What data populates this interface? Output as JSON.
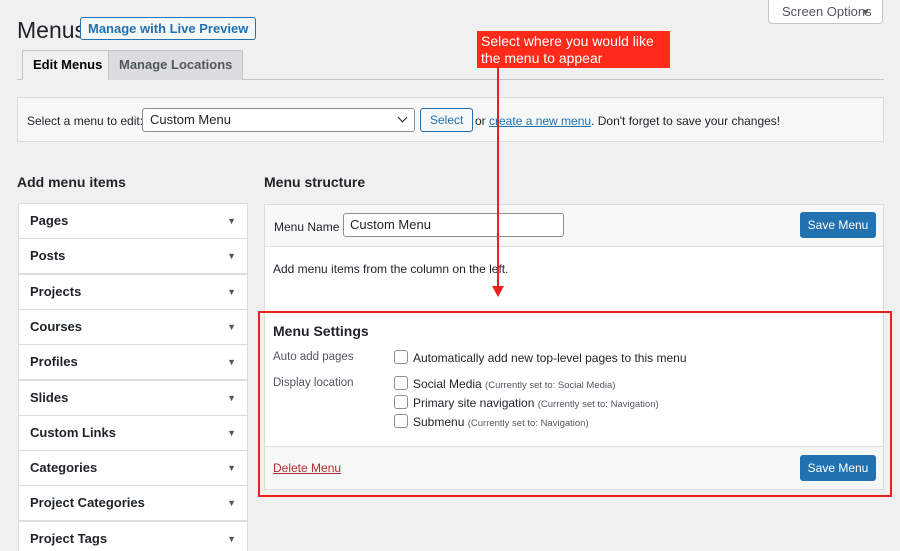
{
  "header": {
    "title": "Menus",
    "live_preview_label": "Manage with Live Preview",
    "screen_options_label": "Screen Options"
  },
  "tabs": [
    {
      "label": "Edit Menus",
      "active": true
    },
    {
      "label": "Manage Locations",
      "active": false
    }
  ],
  "select_menu": {
    "label": "Select a menu to edit:",
    "selected_value": "Custom Menu",
    "select_button": "Select",
    "or_text": "or",
    "create_link": "create a new menu",
    "reminder": ". Don't forget to save your changes!"
  },
  "add_items": {
    "heading": "Add menu items",
    "items": [
      "Pages",
      "Posts",
      "Projects",
      "Courses",
      "Profiles",
      "Slides",
      "Custom Links",
      "Categories",
      "Project Categories",
      "Project Tags"
    ]
  },
  "structure": {
    "heading": "Menu structure",
    "menu_name_label": "Menu Name",
    "menu_name_value": "Custom Menu",
    "save_label": "Save Menu",
    "description": "Add menu items from the column on the left."
  },
  "settings": {
    "heading": "Menu Settings",
    "auto_add_label": "Auto add pages",
    "auto_add_option": "Automatically add new top-level pages to this menu",
    "display_location_label": "Display location",
    "locations": [
      {
        "name": "Social Media",
        "note": "(Currently set to: Social Media)"
      },
      {
        "name": "Primary site navigation",
        "note": "(Currently set to: Navigation)"
      },
      {
        "name": "Submenu",
        "note": "(Currently set to: Navigation)"
      }
    ],
    "delete_label": "Delete Menu",
    "save_label": "Save Menu"
  },
  "annotation": {
    "text": "Select where you would like the menu to appear",
    "color": "#e8231f"
  },
  "colors": {
    "primary": "#2271b1",
    "danger": "#b32d2e",
    "background": "#f0f0f1"
  },
  "icons": {
    "dropdown": "chevron-down-icon",
    "accordion": "triangle-down-icon"
  }
}
